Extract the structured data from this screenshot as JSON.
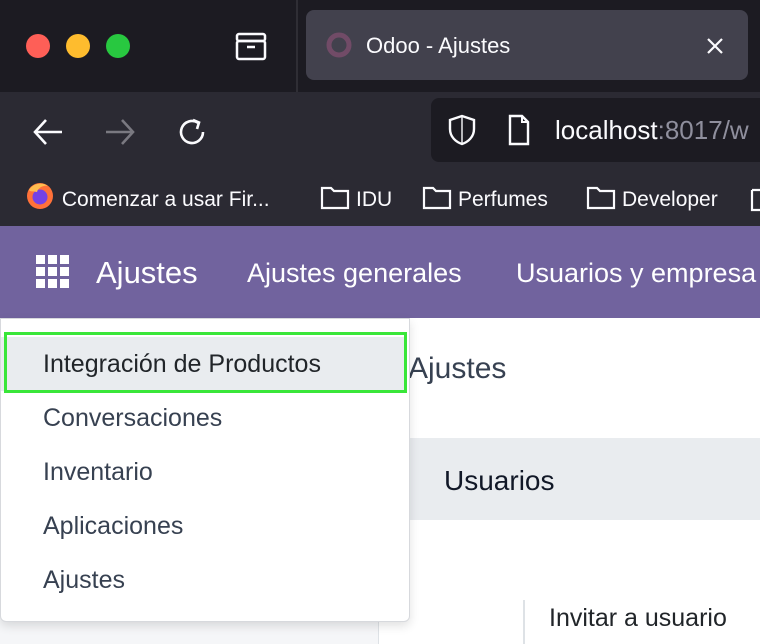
{
  "browser": {
    "tab_title": "Odoo - Ajustes",
    "url_host": "localhost",
    "url_rest": ":8017/w",
    "bookmarks": [
      "Comenzar a usar Fir...",
      "IDU",
      "Perfumes",
      "Developer"
    ]
  },
  "odoo_nav": {
    "app_name": "Ajustes",
    "menu": [
      "Ajustes generales",
      "Usuarios y empresa"
    ]
  },
  "main": {
    "page_title": "Ajustes",
    "section_title": "Usuarios",
    "invite_label": "Invitar a usuario"
  },
  "dropdown": {
    "items": [
      "Integración de Productos",
      "Conversaciones",
      "Inventario",
      "Aplicaciones",
      "Ajustes"
    ]
  },
  "colors": {
    "odoo_brand": "#71639e",
    "highlight": "#39e639"
  }
}
